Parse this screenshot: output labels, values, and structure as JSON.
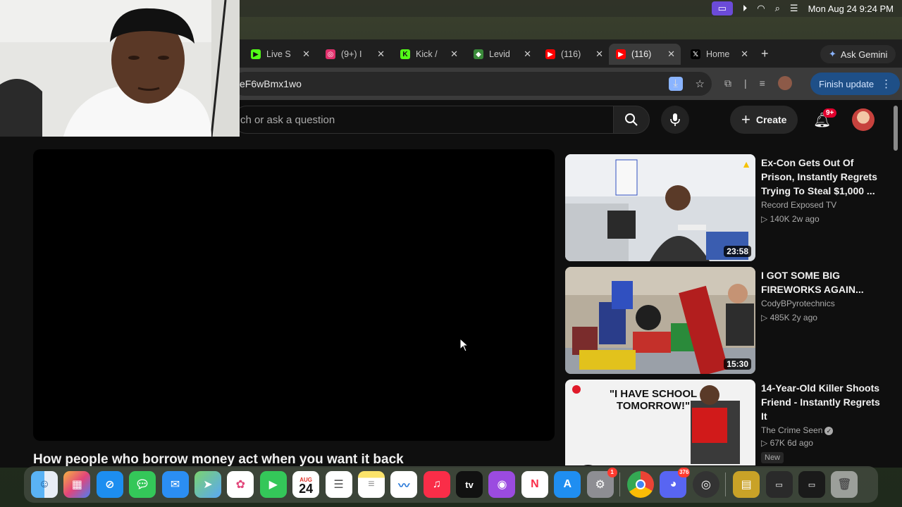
{
  "menubar": {
    "datetime": "Mon Aug 24  9:24 PM"
  },
  "tabs": [
    {
      "label": "Live S",
      "icon": "play-icon",
      "color": "#53fc18"
    },
    {
      "label": "(9+) I",
      "icon": "instagram-icon",
      "color": "#e1306c"
    },
    {
      "label": "Kick /",
      "icon": "kick-icon",
      "color": "#53fc18"
    },
    {
      "label": "Levid",
      "icon": "levid-icon",
      "color": "#3a8a3a"
    },
    {
      "label": "(116)",
      "icon": "youtube-icon",
      "color": "#ff0000"
    },
    {
      "label": "(116)",
      "icon": "youtube-icon",
      "color": "#ff0000"
    },
    {
      "label": "Home",
      "icon": "x-icon",
      "color": "#000000"
    }
  ],
  "browser": {
    "ask_gemini": "Ask Gemini",
    "url": "eF6wBmx1wo",
    "finish_update": "Finish update"
  },
  "youtube": {
    "search_placeholder": "ch or ask a question",
    "create_label": "Create",
    "notification_badge": "9+",
    "video_title": "How people who borrow money act when you want it back",
    "recommendations": [
      {
        "title": "Ex-Con Gets Out Of Prison, Instantly Regrets Trying To Steal $1,000 ...",
        "channel": "Record Exposed TV",
        "meta": "▷ 140K  2w ago",
        "duration": "23:58"
      },
      {
        "title": "I GOT SOME BIG FIREWORKS AGAIN...",
        "channel": "CodyBPyrotechnics",
        "meta": "▷ 485K  2y ago",
        "duration": "15:30"
      },
      {
        "title": "14-Year-Old Killer Shoots Friend - Instantly Regrets It",
        "channel": "The Crime Seen",
        "meta": "▷ 67K  6d ago",
        "badge": "New",
        "thumb_text": "\"I HAVE SCHOOL TOMORROW!\""
      }
    ]
  },
  "dock": {
    "calendar_month": "AUG",
    "calendar_day": "24",
    "appletv_label": "tv",
    "settings_badge": "1",
    "discord_badge": "376"
  }
}
